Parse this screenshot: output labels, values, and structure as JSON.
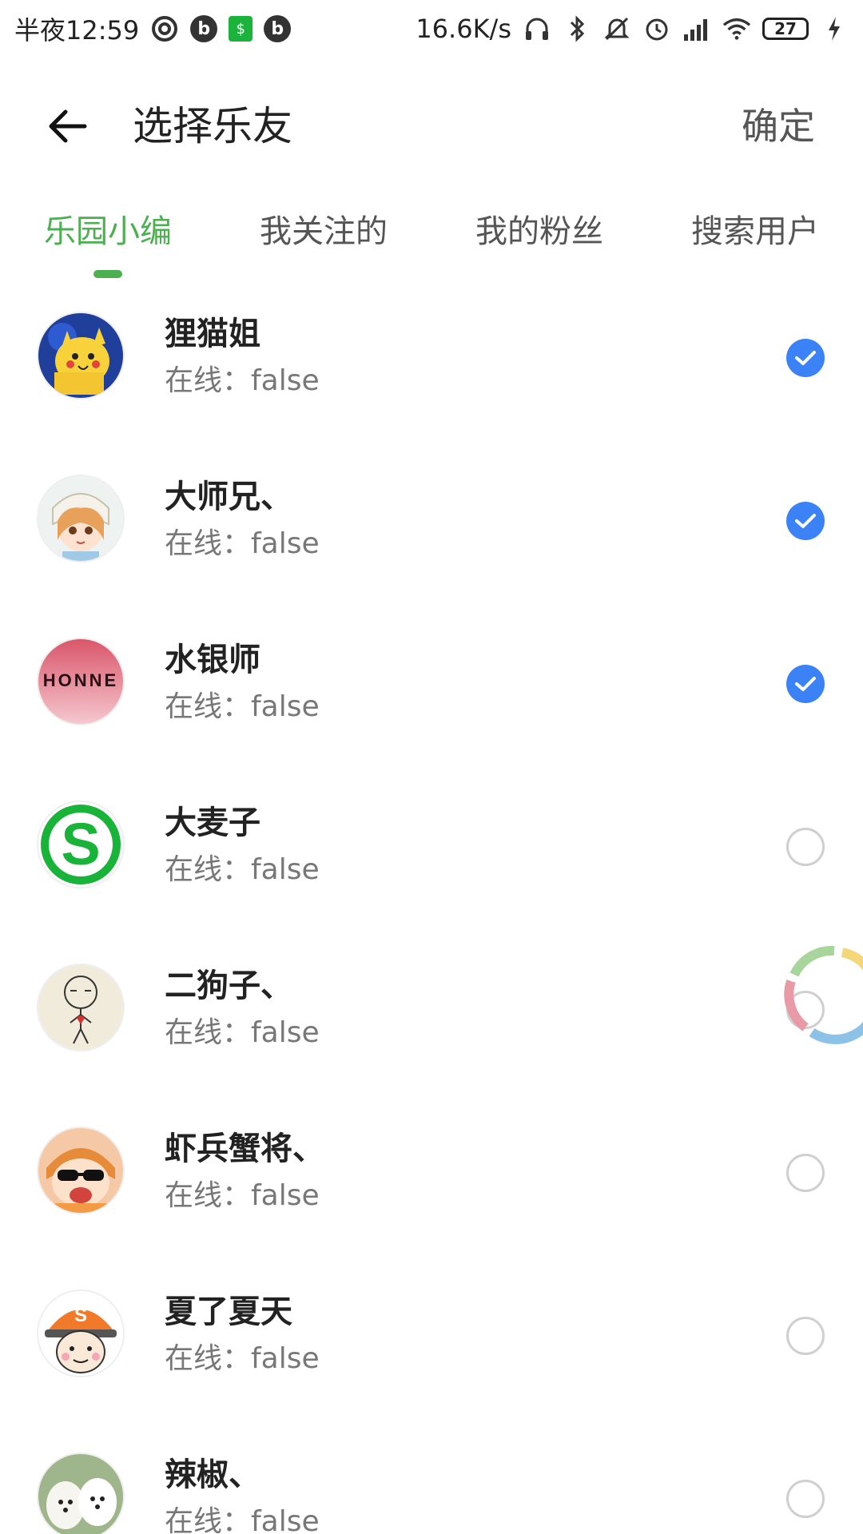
{
  "status_bar": {
    "left_text": "半夜12:59",
    "net_speed": "16.6K/s",
    "battery": "27",
    "icons": [
      "netease-icon",
      "b-icon",
      "shop-icon",
      "b-icon",
      "headphones-icon",
      "bluetooth-icon",
      "mute-icon",
      "alarm-icon",
      "signal-icon",
      "wifi-icon",
      "battery-icon",
      "charging-icon"
    ]
  },
  "header": {
    "title": "选择乐友",
    "confirm_label": "确定",
    "back_icon": "arrow-left-icon"
  },
  "tabs": [
    {
      "label": "乐园小编",
      "active": true
    },
    {
      "label": "我关注的",
      "active": false
    },
    {
      "label": "我的粉丝",
      "active": false
    },
    {
      "label": "搜索用户",
      "active": false
    }
  ],
  "users": [
    {
      "name": "狸猫姐",
      "status": "在线：false",
      "checked": true
    },
    {
      "name": "大师兄、",
      "status": "在线：false",
      "checked": true
    },
    {
      "name": "水银师",
      "status": "在线：false",
      "checked": true
    },
    {
      "name": "大麦子",
      "status": "在线：false",
      "checked": false
    },
    {
      "name": "二狗子、",
      "status": "在线：false",
      "checked": false
    },
    {
      "name": "虾兵蟹将、",
      "status": "在线：false",
      "checked": false
    },
    {
      "name": "夏了夏天",
      "status": "在线：false",
      "checked": false
    },
    {
      "name": "辣椒、",
      "status": "在线：false",
      "checked": false
    }
  ],
  "avatar_texts": {
    "honne": "HONNE",
    "s_letter": "S",
    "s_small": "S"
  },
  "colors": {
    "accent_green": "#4caf50",
    "check_blue": "#3b82f6"
  }
}
